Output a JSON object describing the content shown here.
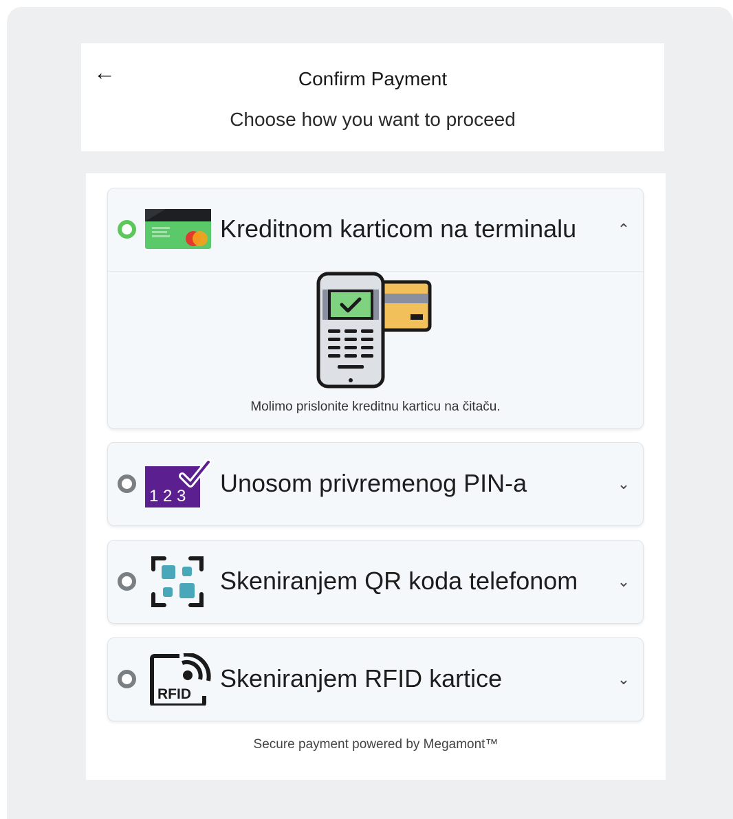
{
  "header": {
    "back_label": "←",
    "title": "Confirm Payment",
    "subtitle": "Choose how you want to proceed"
  },
  "options": [
    {
      "label": "Kreditnom karticom na terminalu",
      "icon": "credit-card-icon",
      "selected": true,
      "expanded": true,
      "hint": "Molimo prislonite kreditnu karticu na čitaču."
    },
    {
      "label": "Unosom privremenog PIN-a",
      "icon": "pin-code-icon",
      "icon_text": "1 2 3",
      "selected": false,
      "expanded": false
    },
    {
      "label": "Skeniranjem QR koda telefonom",
      "icon": "qr-scan-icon",
      "selected": false,
      "expanded": false
    },
    {
      "label": "Skeniranjem RFID kartice",
      "icon": "rfid-card-icon",
      "icon_text": "RFID",
      "selected": false,
      "expanded": false
    }
  ],
  "footer": {
    "text": "Secure payment powered by Megamont™"
  },
  "colors": {
    "selected_radio": "#5cc75a",
    "unselected_radio": "#7a7f83",
    "pin_purple": "#5c1f8f",
    "qr_teal": "#4aa6b9",
    "page_bg": "#eeeff1"
  }
}
